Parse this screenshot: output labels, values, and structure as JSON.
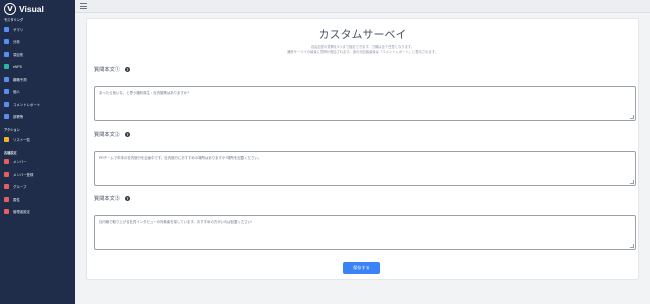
{
  "brand": {
    "name": "Visual",
    "logo_letter": "V"
  },
  "sidebar": {
    "sections": [
      {
        "label": "モニタリング",
        "items": [
          {
            "label": "サマリ",
            "icon": "pie-chart-icon",
            "color": "#5b8def"
          },
          {
            "label": "分析",
            "icon": "bar-chart-icon",
            "color": "#5b8def"
          },
          {
            "label": "項目別",
            "icon": "list-icon",
            "color": "#5b8def"
          },
          {
            "label": "eNPS",
            "icon": "gauge-icon",
            "color": "#2bb5a4"
          },
          {
            "label": "離職予測",
            "icon": "trend-icon",
            "color": "#5b8def"
          },
          {
            "label": "個人",
            "icon": "user-icon",
            "color": "#5b8def"
          },
          {
            "label": "コメントレポート",
            "icon": "comment-icon",
            "color": "#5b8def"
          },
          {
            "label": "部署等",
            "icon": "users-icon",
            "color": "#5b8def"
          }
        ]
      },
      {
        "label": "アクション",
        "items": [
          {
            "label": "リスト一覧",
            "icon": "folder-icon",
            "color": "#f0b429"
          }
        ]
      },
      {
        "label": "各種設定",
        "items": [
          {
            "label": "メンバー",
            "icon": "member-icon",
            "color": "#e85d5d"
          },
          {
            "label": "メンバー登録",
            "icon": "user-add-icon",
            "color": "#e85d5d"
          },
          {
            "label": "グループ",
            "icon": "group-icon",
            "color": "#e85d5d"
          },
          {
            "label": "属性",
            "icon": "tag-icon",
            "color": "#e85d5d"
          },
          {
            "label": "管理者設定",
            "icon": "admin-icon",
            "color": "#e85d5d"
          }
        ]
      }
    ]
  },
  "page": {
    "title": "カスタムサーベイ",
    "description_line1": "自由記述の質問を3つまで指定できます。刀欄は全て任意となります。",
    "description_line2": "通常サーベイの最後に質問が追加されます。追の分記装最後は「コメントレポート」に表示されます。"
  },
  "questions": [
    {
      "label": "質問本文①",
      "value": "あったら良いな、と思う福利厚生・社内施策はありますか?"
    },
    {
      "label": "質問本文②",
      "value": "PRチームで年末の社内旅行を企画中です。社内旅行におすすめの場所はありますか?場所を記載ください。"
    },
    {
      "label": "質問本文③",
      "value": "社内報で取り上げる社員インタビューの対象者を探しています。おすすめの方がいれば記載ください!"
    }
  ],
  "save_button": {
    "label": "保存する",
    "color": "#3b82f6"
  }
}
